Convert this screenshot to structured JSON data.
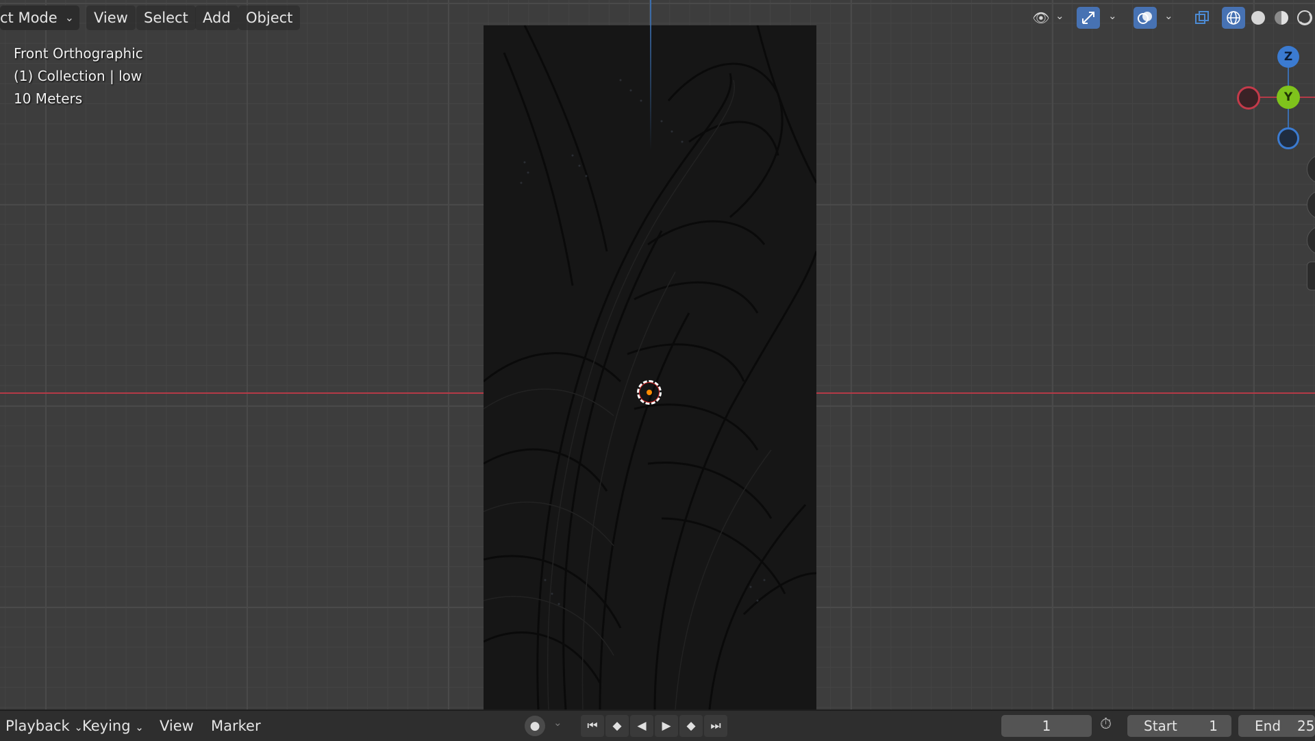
{
  "header": {
    "mode_label": "ct Mode",
    "menu": [
      "View",
      "Select",
      "Add",
      "Object"
    ]
  },
  "overlay": {
    "view_name": "Front Orthographic",
    "collection": "(1) Collection | low",
    "scale": "10 Meters"
  },
  "gizmo": {
    "z": "Z",
    "y": "Y"
  },
  "timeline": {
    "menu": [
      "Playback",
      "Keying",
      "View",
      "Marker"
    ],
    "current_frame": "1",
    "start_label": "Start",
    "start_value": "1",
    "end_label": "End",
    "end_value": "25"
  },
  "colors": {
    "accent_blue": "#4772b3",
    "x_axis": "#b53a47",
    "y_axis": "#7fc31c",
    "z_axis": "#3b7bd1",
    "origin": "#ff8c00"
  },
  "icons": {
    "viewport_gizmo": "eye-icon",
    "gizmo_toggle": "gizmo-icon",
    "overlays": "overlays-icon",
    "xray": "xray-icon",
    "shading_wire": "wireframe-icon",
    "shading_solid": "solid-shading-icon",
    "shading_material": "material-shading-icon",
    "shading_rendered": "rendered-shading-icon",
    "keyframe": "record-icon",
    "jump_start": "jump-start-icon",
    "prev_key": "prev-keyframe-icon",
    "play_reverse": "play-reverse-icon",
    "play": "play-icon",
    "next_key": "next-keyframe-icon",
    "jump_end": "jump-end-icon",
    "stopwatch": "stopwatch-icon"
  }
}
